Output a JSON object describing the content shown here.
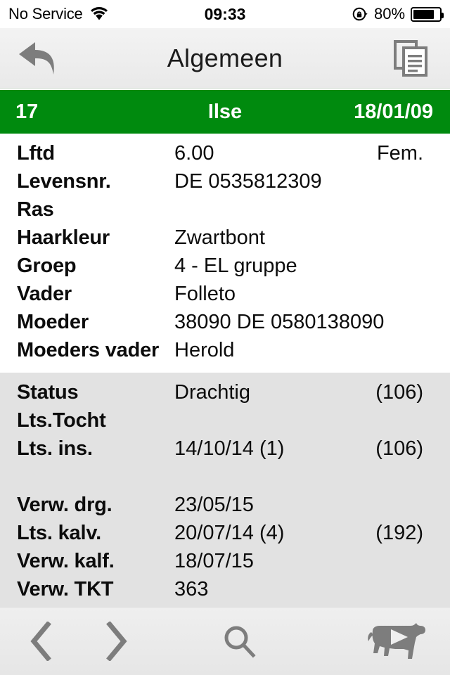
{
  "status_bar": {
    "carrier": "No Service",
    "wifi_icon": "wifi-icon",
    "time": "09:33",
    "rotation_lock_icon": "rotation-lock-icon",
    "battery_percent": "80%",
    "battery_level": 80,
    "battery_icon": "battery-icon"
  },
  "nav_bar": {
    "back_icon": "back-arrow-icon",
    "title": "Algemeen",
    "copy_icon": "copy-documents-icon"
  },
  "record_bar": {
    "animal_number": "17",
    "animal_name": "Ilse",
    "birth_date": "18/01/09",
    "background_color": "#008a0e",
    "text_color": "#ffffff"
  },
  "sections": [
    {
      "name": "identity",
      "background_color": "#ffffff",
      "rows": [
        {
          "label": "Lftd",
          "value": "6.00",
          "extra": "Fem."
        },
        {
          "label": "Levensnr.",
          "value": "DE 0535812309",
          "extra": ""
        },
        {
          "label": "Ras",
          "value": "",
          "extra": ""
        },
        {
          "label": "Haarkleur",
          "value": "Zwartbont",
          "extra": ""
        },
        {
          "label": "Groep",
          "value": "4 - EL gruppe",
          "extra": ""
        },
        {
          "label": "Vader",
          "value": "Folleto",
          "extra": ""
        },
        {
          "label": "Moeder",
          "value": "38090   DE 0580138090",
          "extra": ""
        },
        {
          "label": "Moeders vader",
          "value": "Herold",
          "extra": ""
        }
      ]
    },
    {
      "name": "reproduction",
      "background_color": "#e2e2e2",
      "rows": [
        {
          "label": "Status",
          "value": "Drachtig",
          "extra": "(106)"
        },
        {
          "label": "Lts.Tocht",
          "value": "",
          "extra": ""
        },
        {
          "label": "Lts. ins.",
          "value": "14/10/14 (1)",
          "extra": "(106)"
        },
        {
          "label": "",
          "value": "",
          "extra": ""
        },
        {
          "label": "Verw. drg.",
          "value": "23/05/15",
          "extra": ""
        },
        {
          "label": "Lts. kalv.",
          "value": "20/07/14 (4)",
          "extra": "(192)"
        },
        {
          "label": "Verw. kalf.",
          "value": "18/07/15",
          "extra": ""
        },
        {
          "label": "Verw. TKT",
          "value": "363",
          "extra": ""
        }
      ]
    }
  ],
  "toolbar": {
    "prev_icon": "chevron-left-icon",
    "next_icon": "chevron-right-icon",
    "search_icon": "search-icon",
    "cow_icon": "cow-play-icon",
    "icon_color": "#7d7d7d"
  }
}
